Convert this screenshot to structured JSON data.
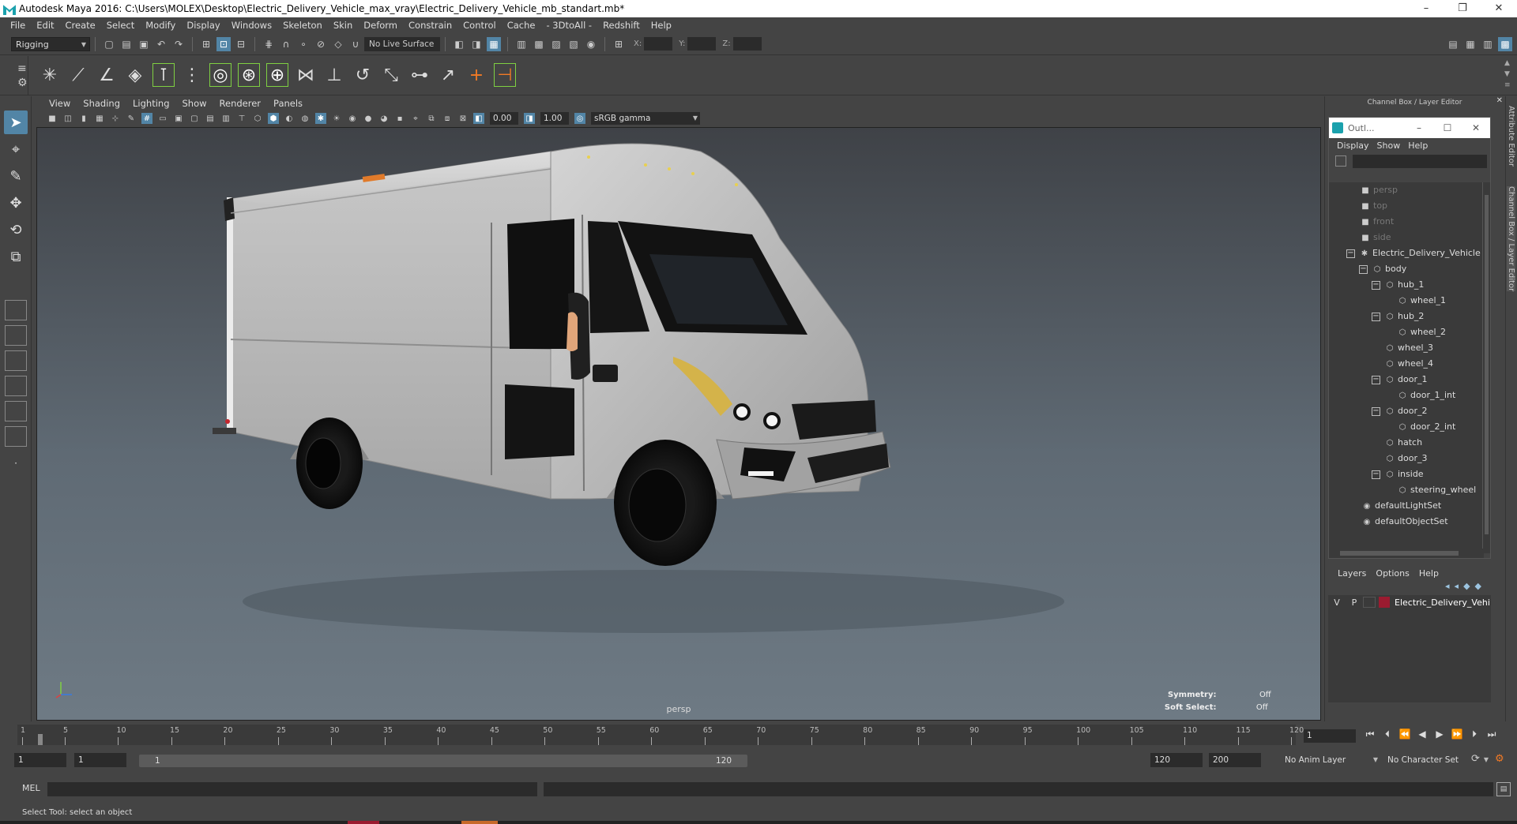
{
  "window": {
    "title": "Autodesk Maya 2016: C:\\Users\\MOLEX\\Desktop\\Electric_Delivery_Vehicle_max_vray\\Electric_Delivery_Vehicle_mb_standart.mb*",
    "controls": [
      "–",
      "❐",
      "✕"
    ]
  },
  "menubar": [
    "File",
    "Edit",
    "Create",
    "Select",
    "Modify",
    "Display",
    "Windows",
    "Skeleton",
    "Skin",
    "Deform",
    "Constrain",
    "Control",
    "Cache",
    "- 3DtoAll -",
    "Redshift",
    "Help"
  ],
  "statusline": {
    "mode": "Rigging",
    "live_surface": "No Live Surface",
    "x_label": "X:",
    "y_label": "Y:",
    "z_label": "Z:"
  },
  "panel": {
    "menu": [
      "View",
      "Shading",
      "Lighting",
      "Show",
      "Renderer",
      "Panels"
    ],
    "exposure": "0.00",
    "gamma_value": "1.00",
    "color_space": "sRGB gamma",
    "camera": "persp",
    "hud": {
      "symmetry_label": "Symmetry:",
      "symmetry_value": "Off",
      "soft_select_label": "Soft Select:",
      "soft_select_value": "Off"
    }
  },
  "channel_box": {
    "title": "Channel Box / Layer Editor"
  },
  "outliner": {
    "title": "Outl...",
    "menu": [
      "Display",
      "Show",
      "Help"
    ],
    "items": [
      {
        "label": "persp",
        "depth": 0,
        "type": "camera"
      },
      {
        "label": "top",
        "depth": 0,
        "type": "camera"
      },
      {
        "label": "front",
        "depth": 0,
        "type": "camera"
      },
      {
        "label": "side",
        "depth": 0,
        "type": "camera"
      },
      {
        "label": "Electric_Delivery_Vehicle",
        "depth": 0,
        "type": "root",
        "expand": "−"
      },
      {
        "label": "body",
        "depth": 1,
        "type": "group",
        "expand": "−"
      },
      {
        "label": "hub_1",
        "depth": 2,
        "type": "group",
        "expand": "−"
      },
      {
        "label": "wheel_1",
        "depth": 3,
        "type": "mesh"
      },
      {
        "label": "hub_2",
        "depth": 2,
        "type": "group",
        "expand": "−"
      },
      {
        "label": "wheel_2",
        "depth": 3,
        "type": "mesh"
      },
      {
        "label": "wheel_3",
        "depth": 2,
        "type": "mesh"
      },
      {
        "label": "wheel_4",
        "depth": 2,
        "type": "mesh"
      },
      {
        "label": "door_1",
        "depth": 2,
        "type": "group",
        "expand": "−"
      },
      {
        "label": "door_1_int",
        "depth": 3,
        "type": "mesh"
      },
      {
        "label": "door_2",
        "depth": 2,
        "type": "group",
        "expand": "−"
      },
      {
        "label": "door_2_int",
        "depth": 3,
        "type": "mesh"
      },
      {
        "label": "hatch",
        "depth": 2,
        "type": "mesh"
      },
      {
        "label": "door_3",
        "depth": 2,
        "type": "mesh"
      },
      {
        "label": "inside",
        "depth": 2,
        "type": "group",
        "expand": "−"
      },
      {
        "label": "steering_wheel",
        "depth": 3,
        "type": "mesh"
      },
      {
        "label": "defaultLightSet",
        "depth": 0,
        "type": "set"
      },
      {
        "label": "defaultObjectSet",
        "depth": 0,
        "type": "set"
      }
    ]
  },
  "layers": {
    "menu": [
      "Layers",
      "Options",
      "Help"
    ],
    "rows": [
      {
        "v": "V",
        "p": "P",
        "color": "#9b1b30",
        "name": "Electric_Delivery_Vehicle"
      }
    ]
  },
  "side_tabs": [
    "Attribute Editor",
    "Channel Box / Layer Editor"
  ],
  "timeline": {
    "ticks": [
      "1",
      "5",
      "10",
      "15",
      "20",
      "25",
      "30",
      "35",
      "40",
      "45",
      "50",
      "55",
      "60",
      "65",
      "70",
      "75",
      "80",
      "85",
      "90",
      "95",
      "100",
      "105",
      "110",
      "115",
      "120"
    ],
    "current_frame": "1"
  },
  "range": {
    "start": "1",
    "playback_start": "1",
    "inner_start": "1",
    "inner_end": "120",
    "playback_end": "120",
    "end": "200",
    "anim_layer": "No Anim Layer",
    "character_set": "No Character Set"
  },
  "command": {
    "mel_label": "MEL"
  },
  "help_line": "Select Tool: select an object",
  "colors": {
    "accent": "#5285a6",
    "maya_teal": "#1ba1ad",
    "active_key": "#f6a53a",
    "layer_red": "#9b1b30"
  }
}
